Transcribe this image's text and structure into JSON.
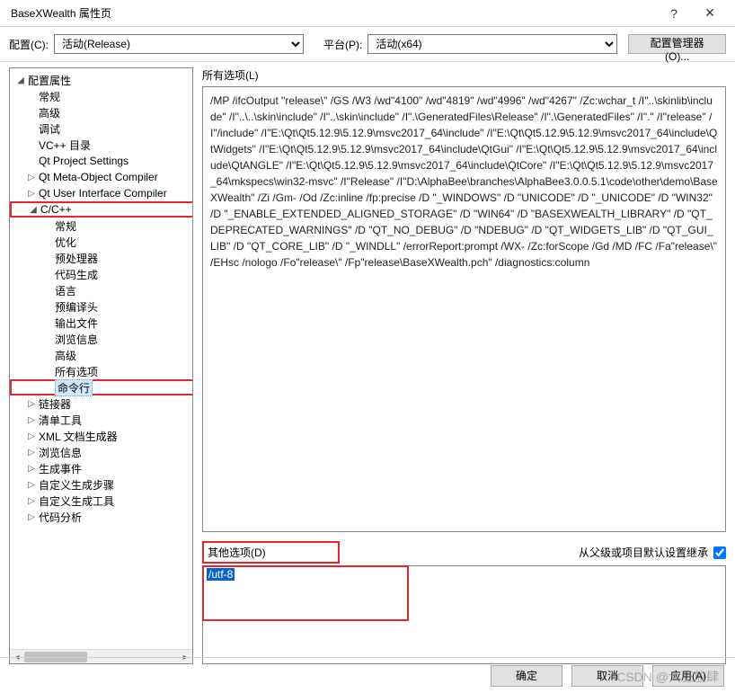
{
  "window": {
    "title": "BaseXWealth 属性页",
    "help": "?",
    "close": "✕"
  },
  "toolbar": {
    "config_label": "配置(C):",
    "config_value": "活动(Release)",
    "platform_label": "平台(P):",
    "platform_value": "活动(x64)",
    "manager_btn": "配置管理器(O)..."
  },
  "tree": {
    "root": "配置属性",
    "general": "常规",
    "advanced": "高级",
    "debug": "调试",
    "vcdirs": "VC++ 目录",
    "qtproj": "Qt Project Settings",
    "qtmoc": "Qt Meta-Object Compiler",
    "qtuic": "Qt User Interface Compiler",
    "ccpp": "C/C++",
    "ccpp_general": "常规",
    "ccpp_opt": "优化",
    "ccpp_pre": "预处理器",
    "ccpp_codegen": "代码生成",
    "ccpp_lang": "语言",
    "ccpp_pch": "预编译头",
    "ccpp_output": "输出文件",
    "ccpp_browse": "浏览信息",
    "ccpp_adv": "高级",
    "ccpp_allopts": "所有选项",
    "ccpp_cmdline": "命令行",
    "linker": "链接器",
    "manifest": "清单工具",
    "xmldoc": "XML 文档生成器",
    "browseinfo": "浏览信息",
    "buildevents": "生成事件",
    "custombuildstep": "自定义生成步骤",
    "custombuildtool": "自定义生成工具",
    "codeanalysis": "代码分析"
  },
  "right": {
    "all_opts_label": "所有选项(L)",
    "all_opts_text": "/MP /ifcOutput \"release\\\" /GS /W3 /wd\"4100\" /wd\"4819\" /wd\"4996\" /wd\"4267\" /Zc:wchar_t /I\"..\\skinlib\\include\" /I\"..\\..\\skin\\include\" /I\"..\\skin\\include\" /I\".\\GeneratedFiles\\Release\" /I\".\\GeneratedFiles\" /I\".\" /I\"release\" /I\"/include\" /I\"E:\\Qt\\Qt5.12.9\\5.12.9\\msvc2017_64\\include\" /I\"E:\\Qt\\Qt5.12.9\\5.12.9\\msvc2017_64\\include\\QtWidgets\" /I\"E:\\Qt\\Qt5.12.9\\5.12.9\\msvc2017_64\\include\\QtGui\" /I\"E:\\Qt\\Qt5.12.9\\5.12.9\\msvc2017_64\\include\\QtANGLE\" /I\"E:\\Qt\\Qt5.12.9\\5.12.9\\msvc2017_64\\include\\QtCore\" /I\"E:\\Qt\\Qt5.12.9\\5.12.9\\msvc2017_64\\mkspecs\\win32-msvc\" /I\"Release\" /I\"D:\\AlphaBee\\branches\\AlphaBee3.0.0.5.1\\code\\other\\demo\\BaseXWealth\" /Zi /Gm- /Od /Zc:inline /fp:precise /D \"_WINDOWS\" /D \"UNICODE\" /D \"_UNICODE\" /D \"WIN32\" /D \"_ENABLE_EXTENDED_ALIGNED_STORAGE\" /D \"WIN64\" /D \"BASEXWEALTH_LIBRARY\" /D \"QT_DEPRECATED_WARNINGS\" /D \"QT_NO_DEBUG\" /D \"NDEBUG\" /D \"QT_WIDGETS_LIB\" /D \"QT_GUI_LIB\" /D \"QT_CORE_LIB\" /D \"_WINDLL\" /errorReport:prompt /WX- /Zc:forScope /Gd /MD /FC /Fa\"release\\\" /EHsc /nologo /Fo\"release\\\" /Fp\"release\\BaseXWealth.pch\" /diagnostics:column",
    "other_label": "其他选项(D)",
    "inherit_label": "从父级或项目默认设置继承",
    "other_value": "/utf-8"
  },
  "footer": {
    "ok": "确定",
    "cancel": "取消",
    "apply": "应用(A)"
  },
  "watermark": "CSDN @大狂放肆"
}
